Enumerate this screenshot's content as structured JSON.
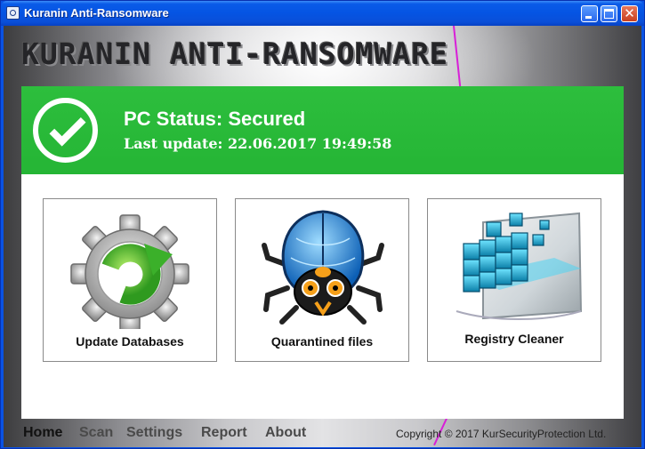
{
  "window": {
    "title": "Kuranin Anti-Ransomware"
  },
  "brand": {
    "name": "KURANIN ANTI-RANSOMWARE"
  },
  "status": {
    "title": "PC Status: Secured",
    "last_update": "Last update: 22.06.2017 19:49:58",
    "color": "#2dbe3d",
    "icon": "checkmark-icon"
  },
  "cards": [
    {
      "label": "Update Databases",
      "icon": "update-gear-icon"
    },
    {
      "label": "Quarantined files",
      "icon": "bug-icon"
    },
    {
      "label": "Registry Cleaner",
      "icon": "registry-cubes-icon"
    }
  ],
  "nav": [
    {
      "label": "Home",
      "active": true
    },
    {
      "label": "Scan"
    },
    {
      "label": "Settings"
    },
    {
      "label": "Report"
    },
    {
      "label": "About"
    }
  ],
  "footer": {
    "copyright": "Copyright © 2017 KurSecurityProtection Ltd."
  }
}
